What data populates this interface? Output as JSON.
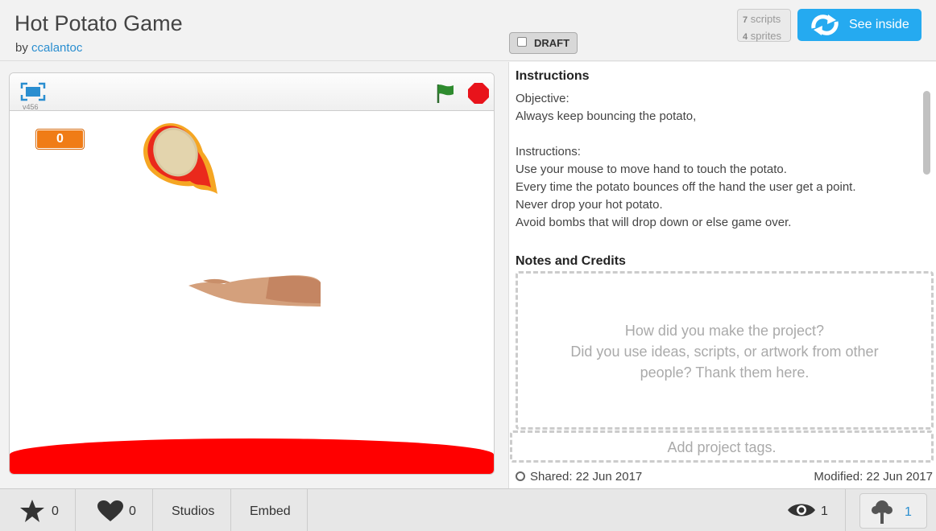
{
  "project": {
    "title": "Hot Potato Game",
    "by_prefix": "by",
    "author": "ccalantoc",
    "draft_label": "DRAFT",
    "scripts_count": "7",
    "scripts_label": "scripts",
    "sprites_count": "4",
    "sprites_label": "sprites",
    "see_inside_label": "See inside"
  },
  "stage": {
    "version": "v456",
    "score": "0"
  },
  "instructions": {
    "heading": "Instructions",
    "lines": [
      "Objective:",
      "Always keep bouncing the potato,",
      "",
      "Instructions:",
      "Use your mouse to move hand to touch the potato.",
      "Every time the potato bounces off the hand the user get a point.",
      "Never drop your hot potato.",
      "Avoid bombs that will drop down or else game over."
    ]
  },
  "notes": {
    "heading": "Notes and Credits",
    "placeholder_line1": "How did you make the project?",
    "placeholder_line2": "Did you use ideas, scripts, or artwork from other",
    "placeholder_line3": "people? Thank them here."
  },
  "tags": {
    "placeholder": "Add project tags."
  },
  "dates": {
    "shared": "Shared: 22 Jun 2017",
    "modified": "Modified: 22 Jun 2017"
  },
  "footer": {
    "favorites": "0",
    "loves": "0",
    "studios": "Studios",
    "embed": "Embed",
    "views": "1",
    "remixes": "1"
  },
  "colors": {
    "accent": "#25aaf0",
    "link": "#2a8ed0",
    "lava": "#ff0000",
    "score_bg": "#f07c16",
    "flag": "#2e8b2e",
    "stop": "#e8131b"
  }
}
